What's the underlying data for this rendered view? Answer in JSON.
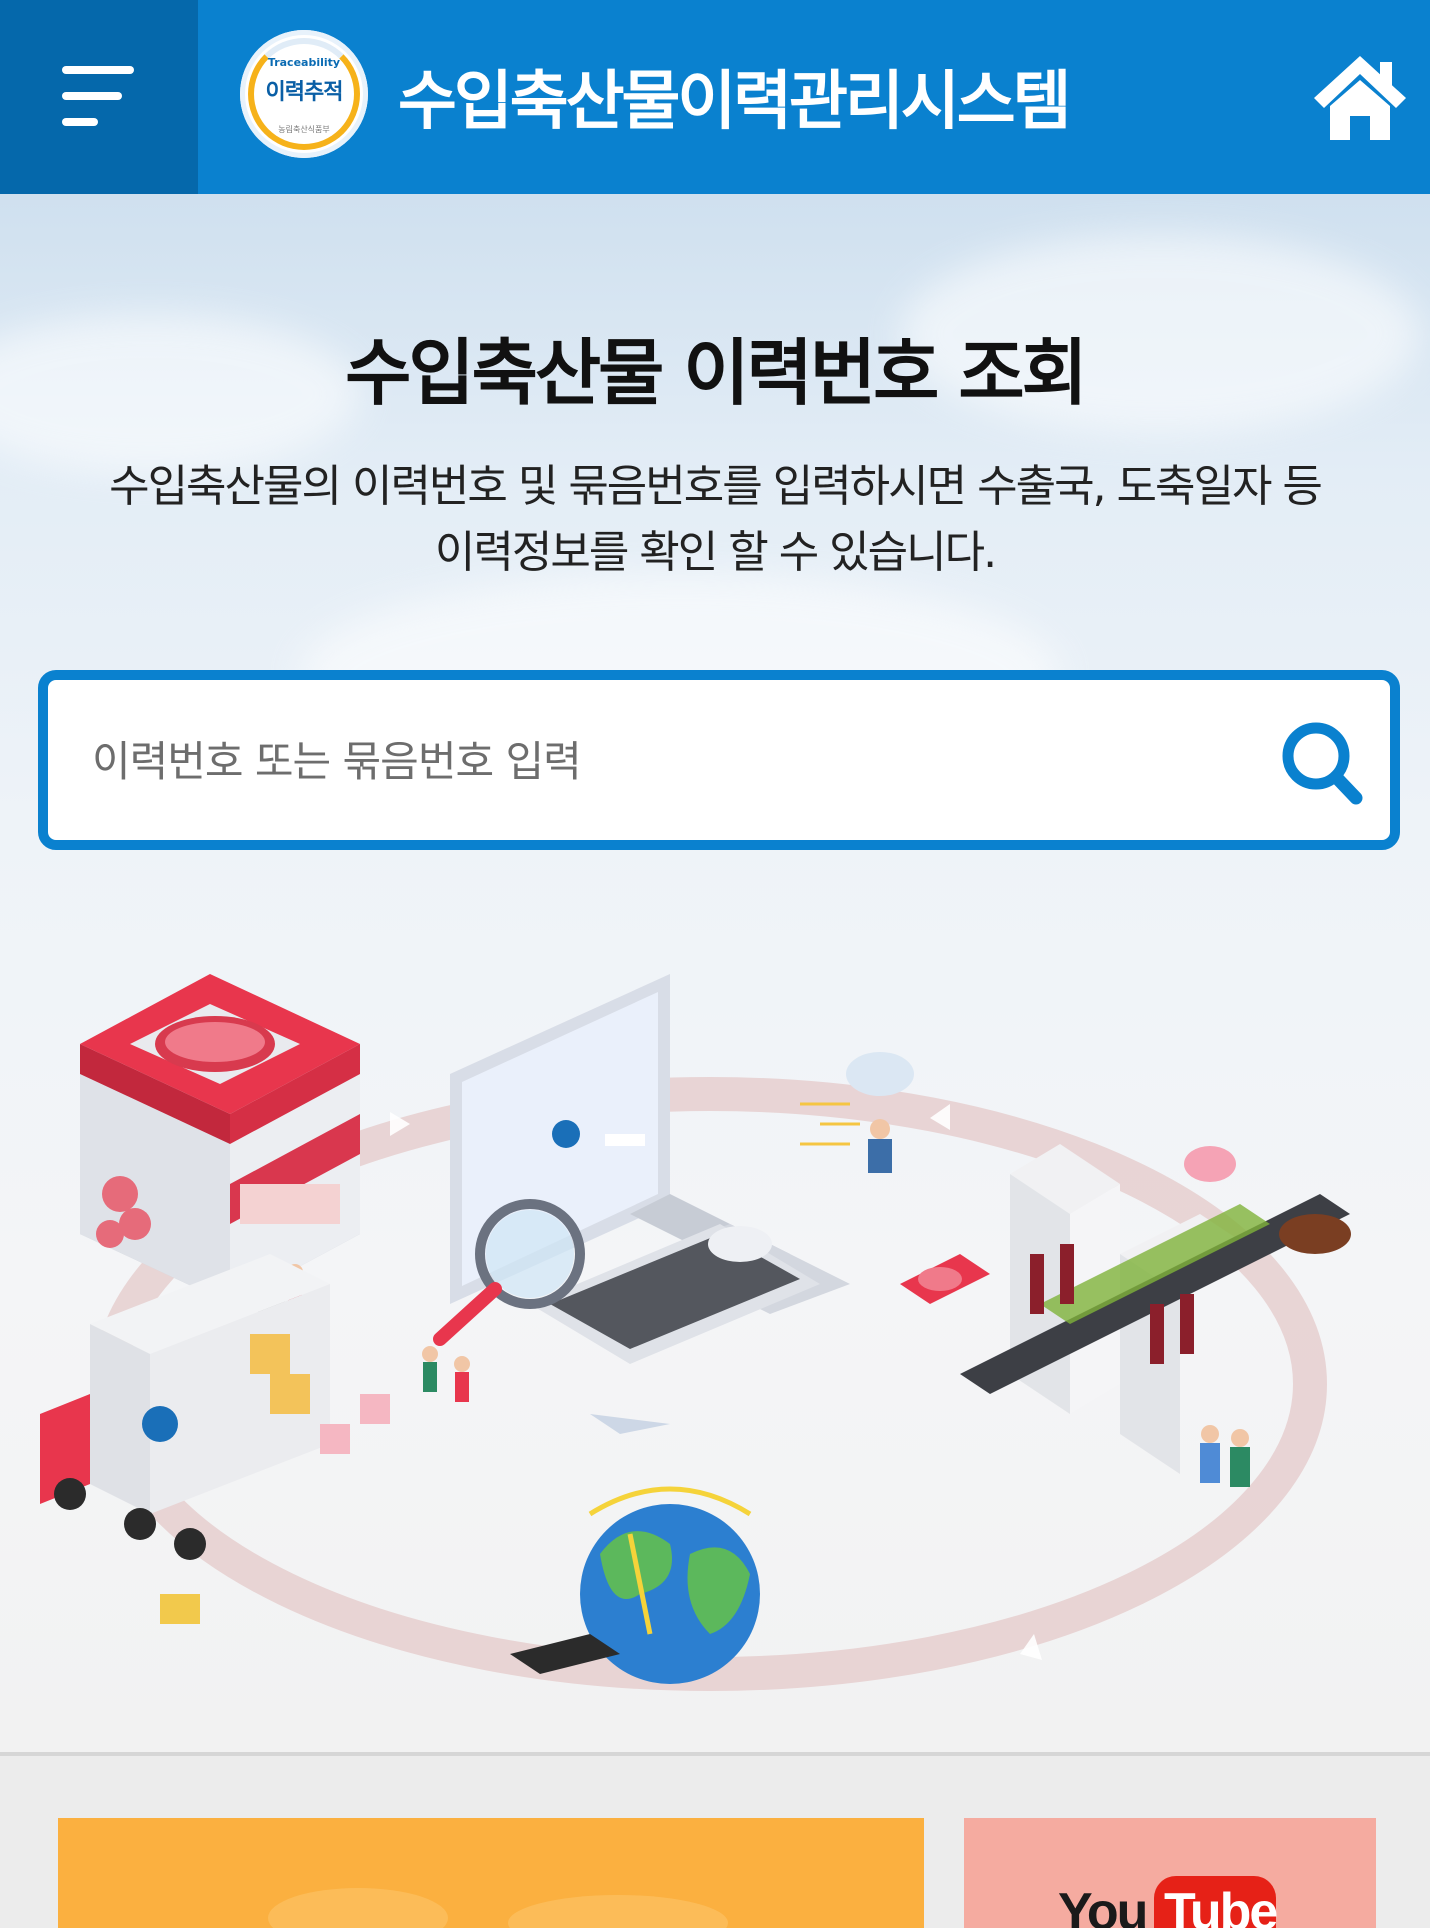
{
  "header": {
    "title": "수입축산물이력관리시스템",
    "logo_small": "Traceability",
    "logo_main": "이력추적",
    "logo_sub": "농림축산식품부",
    "menu_icon": "hamburger-menu-icon",
    "home_icon": "home-icon"
  },
  "hero": {
    "title": "수입축산물 이력번호 조회",
    "desc_line1": "수입축산물의 이력번호 및 묶음번호를 입력하시면 수출국, 도축일자 등",
    "desc_line2": "이력정보를 확인 할 수 있습니다."
  },
  "search": {
    "placeholder": "이력번호 또는 묶음번호 입력",
    "value": "",
    "icon": "search-icon"
  },
  "illustration": {
    "description_icon": "traceability-cycle-illustration"
  },
  "bottom": {
    "youtube_you": "You",
    "youtube_tube": "Tube"
  },
  "colors": {
    "primary": "#0a81cf",
    "menu_bg": "#0568ab",
    "orange_banner": "#fbb040",
    "youtube_banner": "#f5aba0",
    "youtube_red": "#e62117"
  }
}
